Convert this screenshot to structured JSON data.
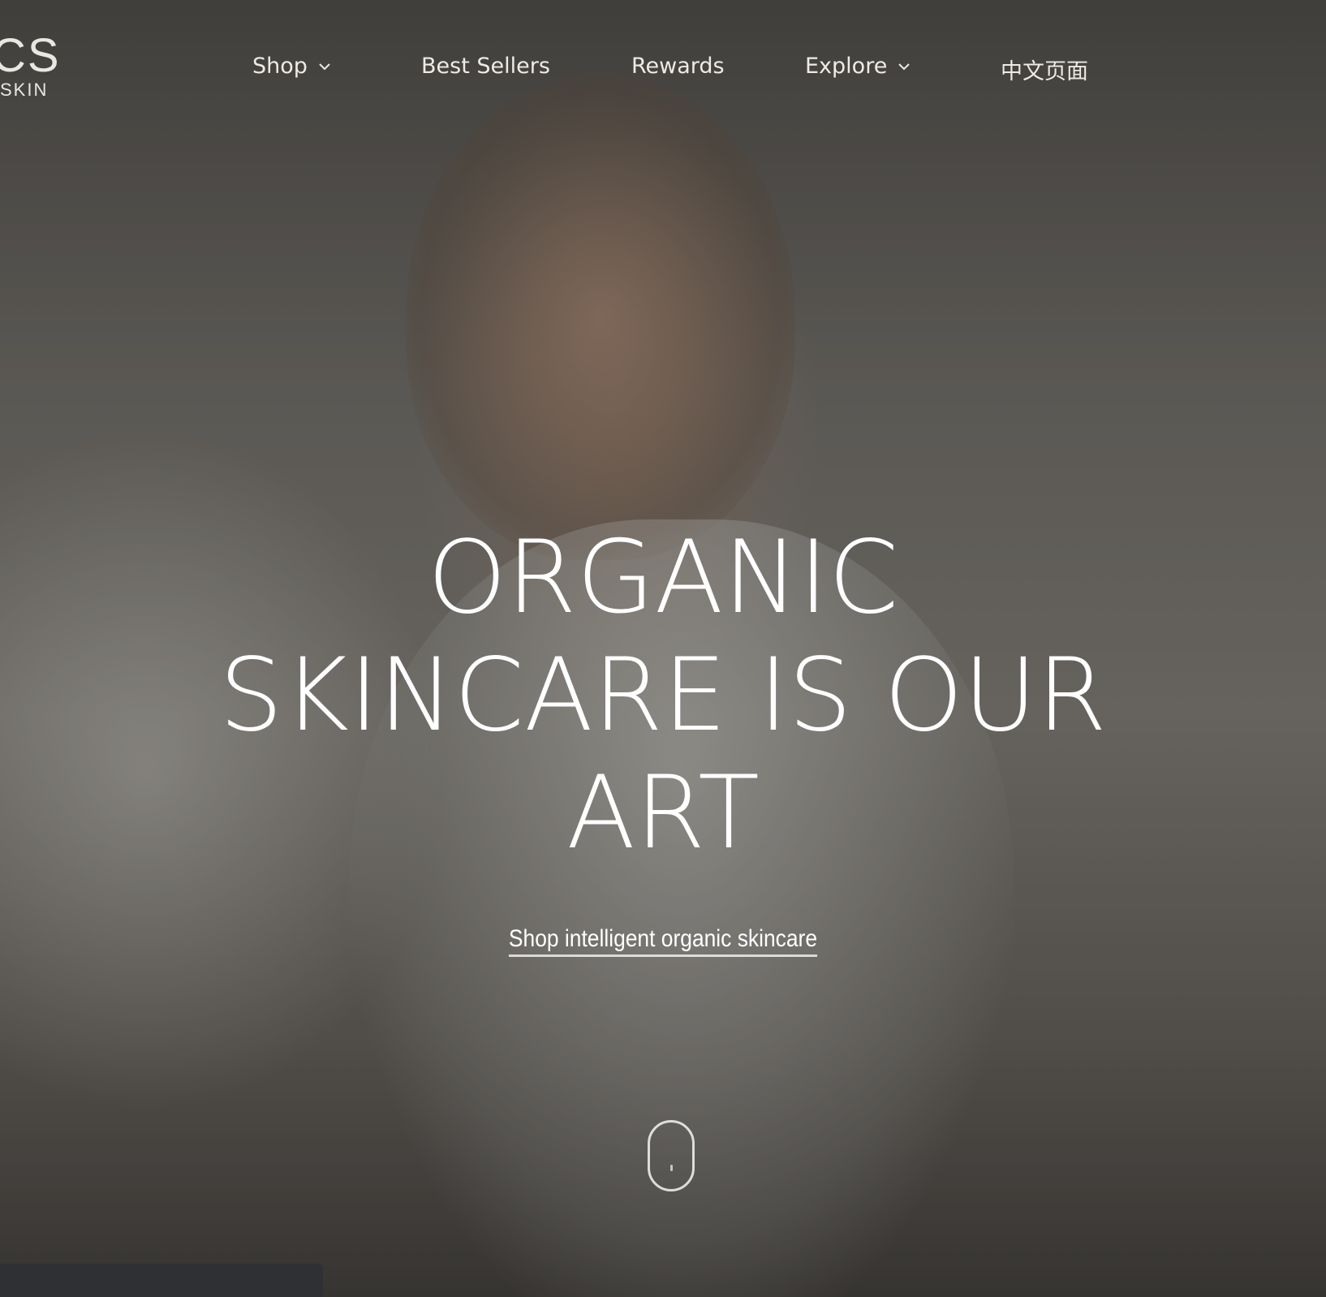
{
  "logo": {
    "mark": "CS",
    "sub": "SKIN"
  },
  "nav": {
    "items": [
      {
        "label": "Shop",
        "has_dropdown": true
      },
      {
        "label": "Best Sellers",
        "has_dropdown": false
      },
      {
        "label": "Rewards",
        "has_dropdown": false
      },
      {
        "label": "Explore",
        "has_dropdown": true
      },
      {
        "label": "中文页面",
        "has_dropdown": false
      }
    ]
  },
  "hero": {
    "headline_lines": [
      "ORGANIC",
      "SKINCARE IS OUR",
      "ART"
    ],
    "cta_label": "Shop intelligent organic skincare"
  },
  "icons": {
    "dropdown": "chevron-down-icon",
    "scroll": "mouse-scroll-icon"
  },
  "colors": {
    "text": "#ffffff",
    "nav_text": "#eeeae5",
    "bottom_bar": "#2f3033"
  }
}
